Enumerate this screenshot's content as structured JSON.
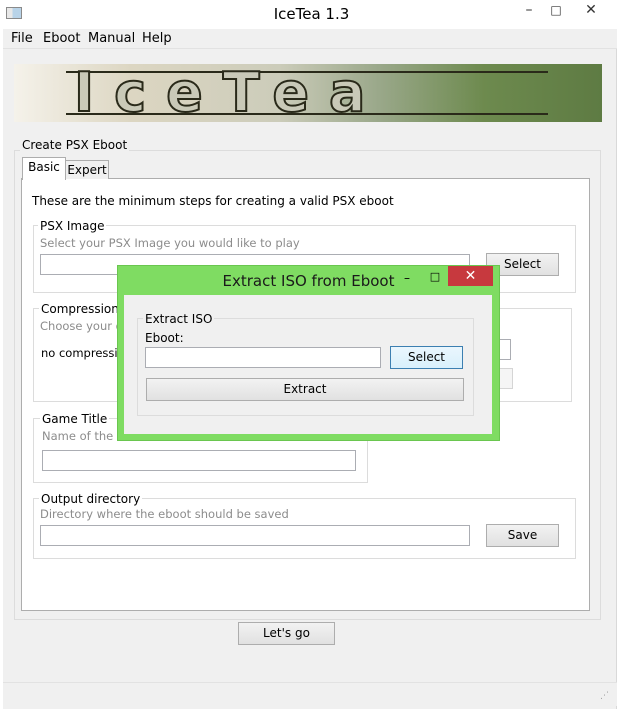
{
  "window": {
    "title": "IceTea 1.3"
  },
  "menu": {
    "items": [
      "File",
      "Eboot",
      "Manual",
      "Help"
    ]
  },
  "banner": {
    "text": "IceTea"
  },
  "create_group": {
    "title": "Create PSX Eboot"
  },
  "tabs": [
    {
      "label": "Basic"
    },
    {
      "label": "Expert"
    }
  ],
  "basic": {
    "intro": "These are the minimum steps for creating a valid PSX eboot",
    "psx_image": {
      "title": "PSX Image",
      "hint": "Select your PSX Image you would like to play",
      "value": "",
      "button": "Select"
    },
    "compression": {
      "title": "Compression",
      "hint": "Choose your des",
      "value": "no compression"
    },
    "game_title": {
      "title": "Game Title",
      "hint": "Name of the eb",
      "value": ""
    },
    "output_dir": {
      "title": "Output directory",
      "hint": "Directory where the eboot should be saved",
      "value": "",
      "button": "Save"
    }
  },
  "go_button": "Let's go",
  "dialog": {
    "title": "Extract ISO from Eboot",
    "controls": {
      "minimize": "–",
      "maximize": "□",
      "close": "✕"
    },
    "group_title": "Extract ISO",
    "eboot_label": "Eboot:",
    "eboot_value": "",
    "select_button": "Select",
    "extract_button": "Extract"
  },
  "window_controls": {
    "minimize": "–",
    "maximize": "□",
    "close": "✕"
  },
  "icons": [
    "app-icon",
    "minimize-icon",
    "maximize-icon",
    "close-icon",
    "resize-grip-icon"
  ],
  "colors": {
    "dialog_frame": "#7fdc62",
    "close_button": "#c7393e",
    "banner_green": "#5e7b43"
  }
}
